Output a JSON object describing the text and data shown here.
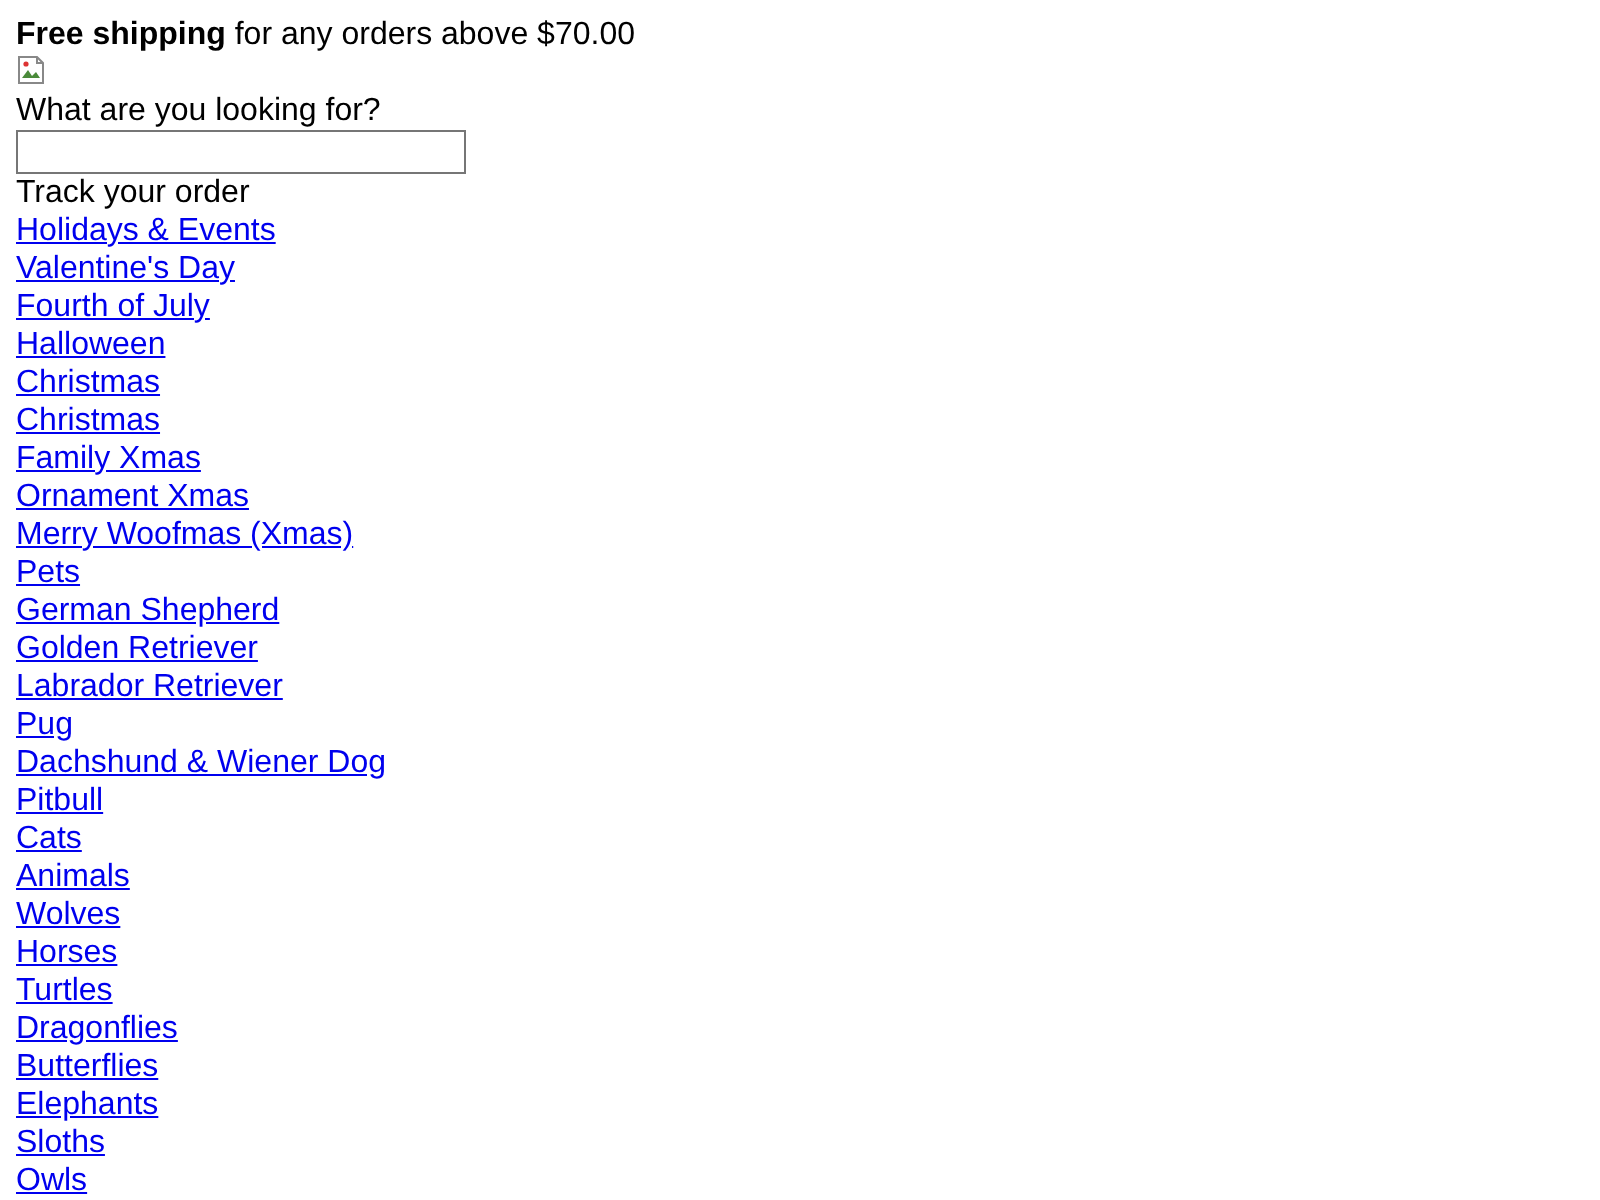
{
  "banner": "**Free shipping** for any orders above $70.00",
  "search": {
    "label": "What are you looking for?"
  },
  "track_order": "Track your order",
  "links": [
    "Holidays & Events",
    "Valentine's Day",
    "Fourth of July",
    "Halloween",
    "Christmas",
    "Christmas",
    "Family Xmas",
    "Ornament Xmas",
    "Merry Woofmas (Xmas)",
    "Pets",
    "German Shepherd",
    "Golden Retriever",
    "Labrador Retriever",
    "Pug",
    "Dachshund & Wiener Dog",
    "Pitbull",
    "Cats",
    "Animals",
    "Wolves",
    "Horses",
    "Turtles",
    "Dragonflies",
    "Butterflies",
    "Elephants",
    "Sloths",
    "Owls"
  ]
}
